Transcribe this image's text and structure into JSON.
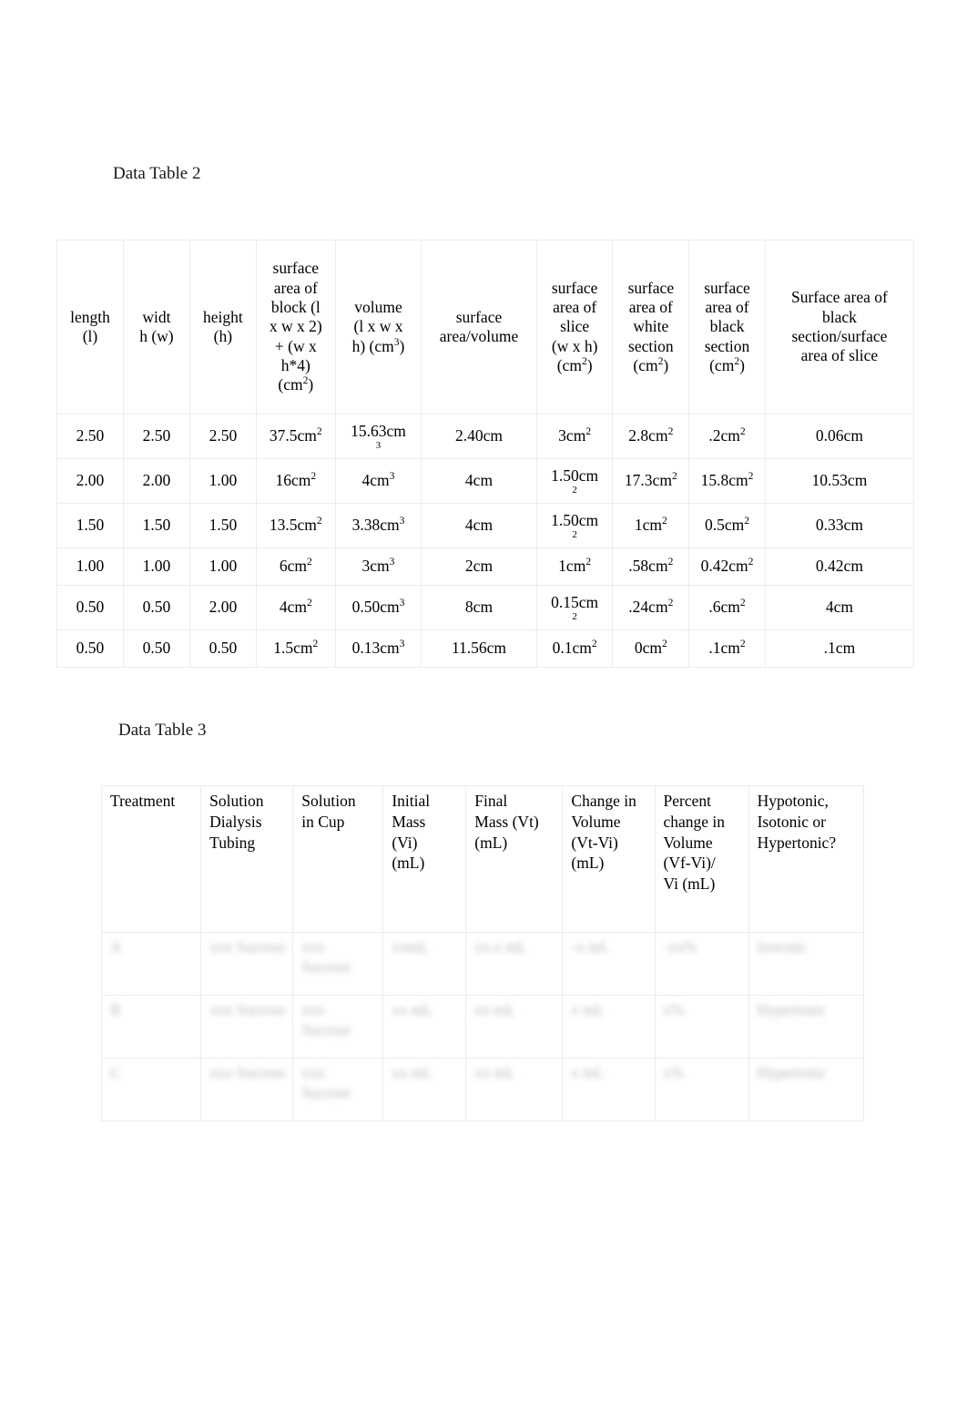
{
  "document": {
    "background_color": "#ffffff",
    "text_color": "#000000",
    "border_color": "#ededed"
  },
  "table2": {
    "title": "Data Table 2",
    "columns": [
      "length (l)",
      "widt h (w)",
      "height (h)",
      "surface area of block (l x w x 2) + (w x h*4) (cm2)",
      "volume (l x w x h) (cm3)",
      "surface area/volume",
      "surface area of slice (w x  h) (cm2)",
      "surface area of white section (cm2)",
      "surface area of black section (cm2)",
      "Surface area of black section/surface area of slice"
    ],
    "header_parts": {
      "length": {
        "line1": "length",
        "line2": "(l)"
      },
      "width": {
        "line1": "widt",
        "line2": "h (w)"
      },
      "height": {
        "line1": "height",
        "line2": "(h)"
      },
      "sa_block": {
        "line1": "surface",
        "line2": "area of",
        "line3": "block (l",
        "line4": "x w x 2)",
        "line5": "+ (w x",
        "line6": "h*4)",
        "line7_base": "(cm",
        "line7_exp": "2",
        "line7_close": ")"
      },
      "volume": {
        "line1": "volume",
        "line2": "(l x w x",
        "line3_base": "h) (cm",
        "line3_exp": "3",
        "line3_close": ")"
      },
      "sa_volume": {
        "line1": "surface",
        "line2": "area/volume"
      },
      "sa_slice": {
        "line1": "surface",
        "line2": "area of",
        "line3": "slice",
        "line4": "(w x  h)",
        "line5_base": "(cm",
        "line5_exp": "2",
        "line5_close": ")"
      },
      "sa_white": {
        "line1": "surface",
        "line2": "area of",
        "line3": "white",
        "line4": "section",
        "line5_base": "(cm",
        "line5_exp": "2",
        "line5_close": ")"
      },
      "sa_black": {
        "line1": "surface",
        "line2": "area of",
        "line3": "black",
        "line4": "section",
        "line5_base": "(cm",
        "line5_exp": "2",
        "line5_close": ")"
      },
      "ratio": {
        "line1": "Surface area of",
        "line2": "black",
        "line3": "section/surface",
        "line4": "area of slice"
      }
    },
    "rows": [
      {
        "length": "2.50",
        "width": "2.50",
        "height": "2.50",
        "sa_block_base": "37.5cm",
        "sa_block_exp": "2",
        "volume_base": "15.63cm",
        "volume_exp": "3",
        "volume_exp_wrapped": true,
        "sa_volume": "2.40cm",
        "sa_slice_base": "3cm",
        "sa_slice_exp": "2",
        "sa_slice_exp_wrapped": false,
        "sa_white_base": "2.8cm",
        "sa_white_exp": "2",
        "sa_black_base": ".2cm",
        "sa_black_exp": "2",
        "ratio": "0.06cm"
      },
      {
        "length": "2.00",
        "width": "2.00",
        "height": "1.00",
        "sa_block_base": "16cm",
        "sa_block_exp": "2",
        "volume_base": "4cm",
        "volume_exp": "3",
        "volume_exp_wrapped": false,
        "sa_volume": "4cm",
        "sa_slice_base": "1.50cm",
        "sa_slice_exp": "2",
        "sa_slice_exp_wrapped": true,
        "sa_white_base": "17.3cm",
        "sa_white_exp": "2",
        "sa_black_base": "15.8cm",
        "sa_black_exp": "2",
        "ratio": "10.53cm"
      },
      {
        "length": "1.50",
        "width": "1.50",
        "height": "1.50",
        "sa_block_base": "13.5cm",
        "sa_block_exp": "2",
        "volume_base": "3.38cm",
        "volume_exp": "3",
        "volume_exp_wrapped": false,
        "sa_volume": "4cm",
        "sa_slice_base": "1.50cm",
        "sa_slice_exp": "2",
        "sa_slice_exp_wrapped": true,
        "sa_white_base": "1cm",
        "sa_white_exp": "2",
        "sa_black_base": "0.5cm",
        "sa_black_exp": "2",
        "ratio": "0.33cm"
      },
      {
        "length": "1.00",
        "width": "1.00",
        "height": "1.00",
        "sa_block_base": "6cm",
        "sa_block_exp": "2",
        "volume_base": "3cm",
        "volume_exp": "3",
        "volume_exp_wrapped": false,
        "sa_volume": "2cm",
        "sa_slice_base": "1cm",
        "sa_slice_exp": "2",
        "sa_slice_exp_wrapped": false,
        "sa_white_base": ".58cm",
        "sa_white_exp": "2",
        "sa_black_base": "0.42cm",
        "sa_black_exp": "2",
        "ratio": "0.42cm"
      },
      {
        "length": "0.50",
        "width": "0.50",
        "height": "2.00",
        "sa_block_base": "4cm",
        "sa_block_exp": "2",
        "volume_base": "0.50cm",
        "volume_exp": "3",
        "volume_exp_wrapped": false,
        "sa_volume": "8cm",
        "sa_slice_base": "0.15cm",
        "sa_slice_exp": "2",
        "sa_slice_exp_wrapped": true,
        "sa_white_base": ".24cm",
        "sa_white_exp": "2",
        "sa_black_base": ".6cm",
        "sa_black_exp": "2",
        "ratio": "4cm"
      },
      {
        "length": "0.50",
        "width": "0.50",
        "height": "0.50",
        "sa_block_base": "1.5cm",
        "sa_block_exp": "2",
        "volume_base": "0.13cm",
        "volume_exp": "3",
        "volume_exp_wrapped": false,
        "sa_volume": "11.56cm",
        "sa_slice_base": "0.1cm",
        "sa_slice_exp": "2",
        "sa_slice_exp_wrapped": false,
        "sa_white_base": "0cm",
        "sa_white_exp": "2",
        "sa_black_base": ".1cm",
        "sa_black_exp": "2",
        "ratio": ".1cm"
      }
    ]
  },
  "table3": {
    "title": "Data Table 3",
    "header_parts": {
      "treatment": {
        "line1": "Treatment"
      },
      "solution_tubing": {
        "line1": "Solution",
        "line2": "Dialysis",
        "line3": "Tubing"
      },
      "solution_cup": {
        "line1": "Solution",
        "line2": "in Cup"
      },
      "initial_mass": {
        "line1": "Initial",
        "line2": "Mass",
        "line3": "(Vi)",
        "line4": "(mL)"
      },
      "final_mass": {
        "line1": "Final",
        "line2": "Mass (Vt)",
        "line3": "(mL)"
      },
      "change_volume": {
        "line1": "Change in",
        "line2": "Volume",
        "line3": "(Vt-Vi)",
        "line4": "(mL)"
      },
      "percent_change": {
        "line1": "Percent",
        "line2": "change in",
        "line3": "Volume",
        "line4": "(Vf-Vi)/",
        "line5": "Vi (mL)"
      },
      "tonicity": {
        "line1": "Hypotonic,",
        "line2": "Isotonic or",
        "line3": "Hypertonic?"
      }
    },
    "columns": [
      "Treatment",
      "Solution Dialysis Tubing",
      "Solution in Cup",
      "Initial Mass (Vi) (mL)",
      "Final Mass (Vt) (mL)",
      "Change in Volume (Vt-Vi) (mL)",
      "Percent change in Volume (Vf-Vi)/ Vi (mL)",
      "Hypotonic, Isotonic or Hypertonic?"
    ],
    "rows_note": "body cell contents are visually blurred/illegible in the source image",
    "rows": [
      {
        "treatment": "A",
        "solution_tubing": "xxx Sucrose",
        "solution_cup": "xxx Sucrose",
        "initial_mass": "xxmL",
        "final_mass": "xx.x mL",
        "change_volume": "-x mL",
        "percent_change": "-xx%",
        "tonicity": "Isotonic"
      },
      {
        "treatment": "B",
        "solution_tubing": "xxx Sucrose",
        "solution_cup": "xxx Sucrose",
        "initial_mass": "xx mL",
        "final_mass": "xx mL",
        "change_volume": "x mL",
        "percent_change": "x%",
        "tonicity": "Hypertonic"
      },
      {
        "treatment": "C",
        "solution_tubing": "xxx Sucrose",
        "solution_cup": "xxx Sucrose",
        "initial_mass": "xx mL",
        "final_mass": "xx mL",
        "change_volume": "x mL",
        "percent_change": "x%",
        "tonicity": "Hypertonic"
      }
    ]
  }
}
